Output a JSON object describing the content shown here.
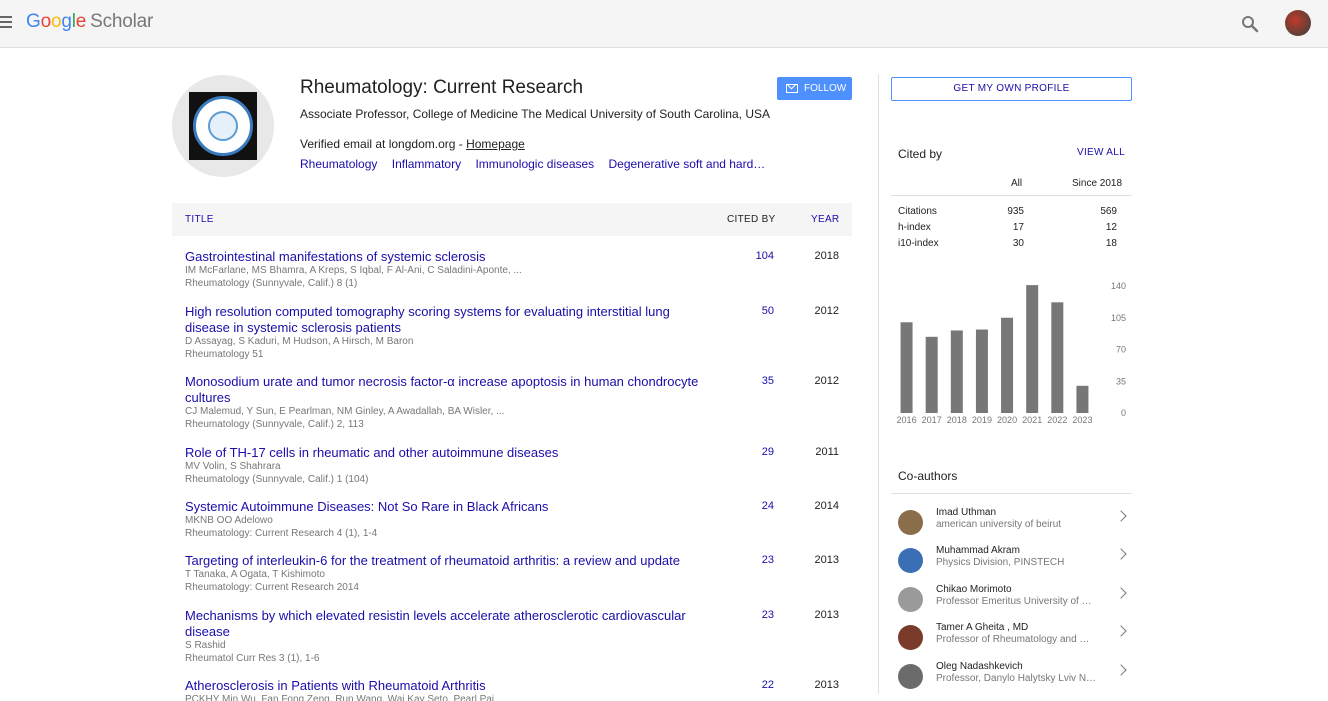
{
  "app": {
    "logo_google": "Google",
    "logo_scholar": "Scholar"
  },
  "profile": {
    "name": "Rheumatology: Current Research",
    "affiliation": "Associate Professor, College of Medicine The Medical University of South Carolina, USA",
    "email_text": "Verified email at longdom.org - ",
    "homepage": "Homepage",
    "interests": [
      "Rheumatology",
      "Inflammatory",
      "Immunologic diseases",
      "Degenerative soft and hard…"
    ],
    "follow_label": "FOLLOW"
  },
  "table": {
    "headers": {
      "title": "TITLE",
      "cited": "CITED BY",
      "year": "YEAR"
    },
    "rows": [
      {
        "title": "Gastrointestinal manifestations of systemic sclerosis",
        "authors": "IM McFarlane, MS Bhamra, A Kreps, S Iqbal, F Al-Ani, C Saladini-Aponte, ...",
        "venue": "Rheumatology (Sunnyvale, Calif.) 8 (1)",
        "cited": "104",
        "year": "2018"
      },
      {
        "title": "High resolution computed tomography scoring systems for evaluating interstitial lung disease in systemic sclerosis patients",
        "authors": "D Assayag, S Kaduri, M Hudson, A Hirsch, M Baron",
        "venue": "Rheumatology 51",
        "cited": "50",
        "year": "2012"
      },
      {
        "title": "Monosodium urate and tumor necrosis factor-α increase apoptosis in human chondrocyte cultures",
        "authors": "CJ Malemud, Y Sun, E Pearlman, NM Ginley, A Awadallah, BA Wisler, ...",
        "venue": "Rheumatology (Sunnyvale, Calif.) 2, 113",
        "cited": "35",
        "year": "2012"
      },
      {
        "title": "Role of TH-17 cells in rheumatic and other autoimmune diseases",
        "authors": "MV Volin, S Shahrara",
        "venue": "Rheumatology (Sunnyvale, Calif.) 1 (104)",
        "cited": "29",
        "year": "2011"
      },
      {
        "title": "Systemic Autoimmune Diseases: Not So Rare in Black Africans",
        "authors": "MKNB OO Adelowo",
        "venue": "Rheumatology: Current Research 4 (1), 1-4",
        "cited": "24",
        "year": "2014"
      },
      {
        "title": "Targeting of interleukin-6 for the treatment of rheumatoid arthritis: a review and update",
        "authors": "T Tanaka, A Ogata, T Kishimoto",
        "venue": "Rheumatology: Current Research 2014",
        "cited": "23",
        "year": "2013"
      },
      {
        "title": "Mechanisms by which elevated resistin levels accelerate atherosclerotic cardiovascular disease",
        "authors": "S Rashid",
        "venue": "Rheumatol Curr Res 3 (1), 1-6",
        "cited": "23",
        "year": "2013"
      },
      {
        "title": "Atherosclerosis in Patients with Rheumatoid Arthritis",
        "authors": "PCKHY Min Wu, Fan Fong Zeng, Run Wang, Wai Kay Seto, Pearl Pai",
        "venue": "",
        "cited": "22",
        "year": "2013"
      }
    ]
  },
  "sidebar": {
    "own_profile": "GET MY OWN PROFILE",
    "cited_by_title": "Cited by",
    "view_all": "VIEW ALL",
    "col_all": "All",
    "col_since": "Since 2018",
    "stats": [
      {
        "label": "Citations",
        "all": "935",
        "since": "569"
      },
      {
        "label": "h-index",
        "all": "17",
        "since": "12"
      },
      {
        "label": "i10-index",
        "all": "30",
        "since": "18"
      }
    ],
    "coauthors_title": "Co-authors",
    "coauthors": [
      {
        "name": "Imad Uthman",
        "affil": "american university of beirut",
        "color": "#8a6d4a"
      },
      {
        "name": "Muhammad Akram",
        "affil": "Physics Division, PINSTECH",
        "color": "#3b6fb5"
      },
      {
        "name": "Chikao Morimoto",
        "affil": "Professor Emeritus University of …",
        "color": "#9a9a9a"
      },
      {
        "name": "Tamer A Gheita , MD",
        "affil": "Professor of Rheumatology and …",
        "color": "#7a3b2a"
      },
      {
        "name": "Oleg Nadashkevich",
        "affil": "Professor, Danylo Halytsky Lviv N…",
        "color": "#6b6b6b"
      }
    ]
  },
  "chart_data": {
    "type": "bar",
    "categories": [
      "2016",
      "2017",
      "2018",
      "2019",
      "2020",
      "2021",
      "2022",
      "2023"
    ],
    "values": [
      100,
      84,
      91,
      92,
      105,
      141,
      122,
      30
    ],
    "yticks": [
      "140",
      "105",
      "70",
      "35",
      "0"
    ],
    "ylim": [
      0,
      140
    ],
    "color": "#777777"
  }
}
